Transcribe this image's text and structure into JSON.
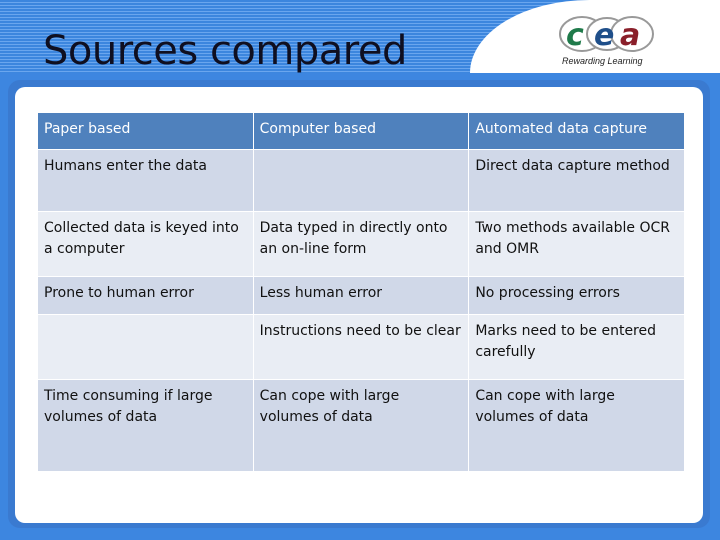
{
  "slide": {
    "title": "Sources compared",
    "logo": {
      "text": "cea",
      "tagline": "Rewarding Learning",
      "colors": [
        "#1f7a4a",
        "#1f4f8a",
        "#8a1f2a"
      ]
    }
  },
  "table": {
    "headers": [
      "Paper based",
      "Computer  based",
      "Automated data capture"
    ],
    "rows": [
      [
        "Humans enter the data",
        "",
        "Direct data capture method"
      ],
      [
        "Collected data is keyed into a computer",
        "Data typed in directly onto an on-line form",
        "Two methods available OCR and OMR"
      ],
      [
        "Prone to human error",
        "Less human error",
        "No processing errors"
      ],
      [
        "",
        "Instructions need to be clear",
        "Marks need to be entered carefully"
      ],
      [
        "Time consuming if large volumes of data",
        "Can cope with large volumes of data",
        "Can cope with large volumes of data"
      ]
    ]
  },
  "colors": {
    "header_bg": "#4f81bd",
    "row_dark": "#d0d8e8",
    "row_light": "#e9edf4",
    "frame": "#3d86e0"
  }
}
